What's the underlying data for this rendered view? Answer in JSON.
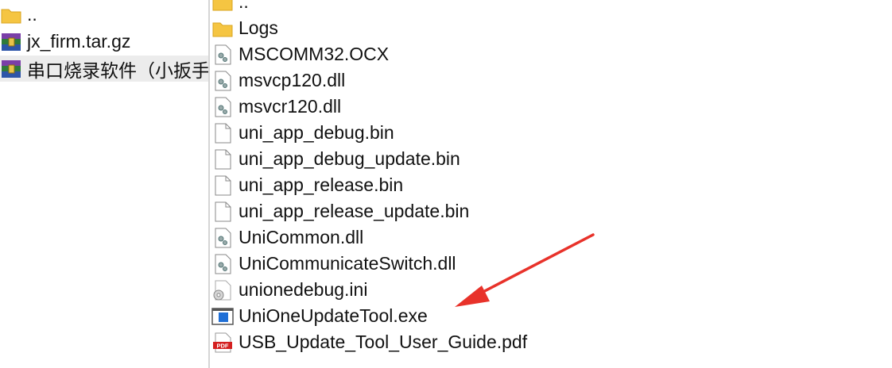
{
  "left": {
    "items": [
      {
        "label": "..",
        "icon": "folder-icon"
      },
      {
        "label": "jx_firm.tar.gz",
        "icon": "archive-icon"
      },
      {
        "label": "串口烧录软件（小扳手",
        "icon": "archive-icon"
      }
    ]
  },
  "right": {
    "items": [
      {
        "label": "..",
        "icon": "folder-icon"
      },
      {
        "label": "Logs",
        "icon": "folder-icon"
      },
      {
        "label": "MSCOMM32.OCX",
        "icon": "system-file-icon"
      },
      {
        "label": "msvcp120.dll",
        "icon": "system-file-icon"
      },
      {
        "label": "msvcr120.dll",
        "icon": "system-file-icon"
      },
      {
        "label": "uni_app_debug.bin",
        "icon": "blank-file-icon"
      },
      {
        "label": "uni_app_debug_update.bin",
        "icon": "blank-file-icon"
      },
      {
        "label": "uni_app_release.bin",
        "icon": "blank-file-icon"
      },
      {
        "label": "uni_app_release_update.bin",
        "icon": "blank-file-icon"
      },
      {
        "label": "UniCommon.dll",
        "icon": "system-file-icon"
      },
      {
        "label": "UniCommunicateSwitch.dll",
        "icon": "system-file-icon"
      },
      {
        "label": "unionedebug.ini",
        "icon": "settings-file-icon"
      },
      {
        "label": "UniOneUpdateTool.exe",
        "icon": "exe-icon"
      },
      {
        "label": "USB_Update_Tool_User_Guide.pdf",
        "icon": "pdf-icon"
      }
    ]
  },
  "colors": {
    "arrow": "#e8322a",
    "folder": "#f5c542",
    "pdf": "#d42020",
    "selected_row": "#ececec"
  }
}
